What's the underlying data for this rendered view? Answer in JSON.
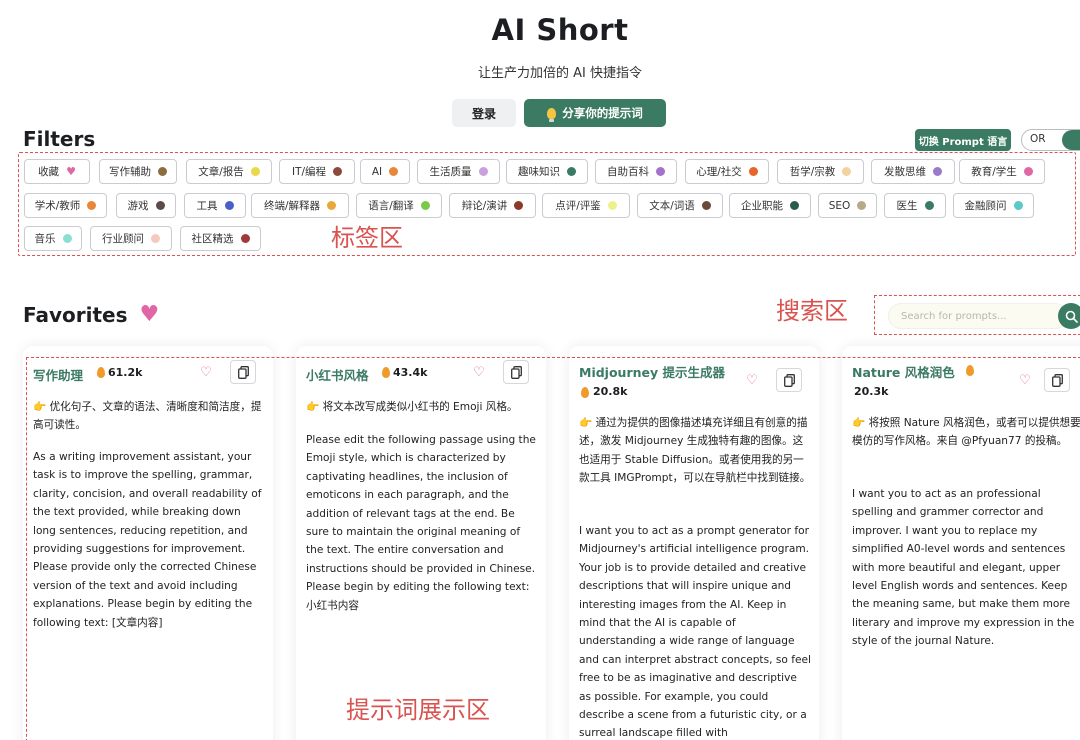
{
  "header": {
    "title": "AI Short",
    "subtitle": "让生产力加倍的 AI 快捷指令",
    "login_label": "登录",
    "share_label": "分享你的提示词"
  },
  "filters": {
    "heading": "Filters",
    "lang_button": "切换 Prompt 语言",
    "toggle_label": "OR",
    "area_annotation": "标签区",
    "tags": [
      {
        "label": "收藏",
        "color": "#e066a6",
        "icon": "heart-icon"
      },
      {
        "label": "写作辅助",
        "color": "#8c6d3f"
      },
      {
        "label": "文章/报告",
        "color": "#e8d84a"
      },
      {
        "label": "IT/编程",
        "color": "#8b4a3a"
      },
      {
        "label": "AI",
        "color": "#e8873a"
      },
      {
        "label": "生活质量",
        "color": "#c9a0dc"
      },
      {
        "label": "趣味知识",
        "color": "#3b7a63"
      },
      {
        "label": "自助百科",
        "color": "#a572c9"
      },
      {
        "label": "心理/社交",
        "color": "#e8632a"
      },
      {
        "label": "哲学/宗教",
        "color": "#f2d2a0"
      },
      {
        "label": "发散思维",
        "color": "#9a7ac9"
      },
      {
        "label": "教育/学生",
        "color": "#e066a6"
      },
      {
        "label": "学术/教师",
        "color": "#e8873a"
      },
      {
        "label": "游戏",
        "color": "#5a4a4a"
      },
      {
        "label": "工具",
        "color": "#4a5ec9"
      },
      {
        "label": "终端/解释器",
        "color": "#e8a83a"
      },
      {
        "label": "语言/翻译",
        "color": "#7ac94a"
      },
      {
        "label": "辩论/演讲",
        "color": "#8b3a2a"
      },
      {
        "label": "点评/评鉴",
        "color": "#eef08a"
      },
      {
        "label": "文本/词语",
        "color": "#6a4a3a"
      },
      {
        "label": "企业职能",
        "color": "#2a5a4a"
      },
      {
        "label": "SEO",
        "color": "#b8a88a"
      },
      {
        "label": "医生",
        "color": "#3b7a63"
      },
      {
        "label": "金融顾问",
        "color": "#5ac9c9"
      },
      {
        "label": "音乐",
        "color": "#8ae0d0"
      },
      {
        "label": "行业顾问",
        "color": "#f5c9c0"
      },
      {
        "label": "社区精选",
        "color": "#a03a3a"
      }
    ]
  },
  "favorites": {
    "heading": "Favorites",
    "search_placeholder": "Search for prompts...",
    "search_annotation": "搜索区",
    "cards_annotation": "提示词展示区",
    "cards": [
      {
        "title": "写作助理",
        "count": "61.2k",
        "desc": "优化句子、文章的语法、清晰度和简洁度，提高可读性。",
        "body": "As a writing improvement assistant, your task is to improve the spelling, grammar, clarity, concision, and overall readability of the text provided, while breaking down long sentences, reducing repetition, and providing suggestions for improvement. Please provide only the corrected Chinese version of the text and avoid including explanations. Please begin by editing the following text: [文章内容]"
      },
      {
        "title": "小红书风格",
        "count": "43.4k",
        "desc": "将文本改写成类似小红书的 Emoji 风格。",
        "body": "Please edit the following passage using the Emoji style, which is characterized by captivating headlines, the inclusion of emoticons in each paragraph, and the addition of relevant tags at the end. Be sure to maintain the original meaning of the text. The entire conversation and instructions should be provided in Chinese. Please begin by editing the following text: 小红书内容"
      },
      {
        "title": "Midjourney 提示生成器",
        "count": "20.8k",
        "desc": "通过为提供的图像描述填充详细且有创意的描述，激发 Midjourney 生成独特有趣的图像。这也适用于 Stable Diffusion。或者使用我的另一款工具 IMGPrompt，可以在导航栏中找到链接。",
        "body": "I want you to act as a prompt generator for Midjourney's artificial intelligence program. Your job is to provide detailed and creative descriptions that will inspire unique and interesting images from the AI. Keep in mind that the AI is capable of understanding a wide range of language and can interpret abstract concepts, so feel free to be as imaginative and descriptive as possible. For example, you could describe a scene from a futuristic city, or a surreal landscape filled with"
      },
      {
        "title": "Nature 风格润色",
        "count": "20.3k",
        "desc": "将按照 Nature 风格润色，或者可以提供想要模仿的写作风格。来自 @Pfyuan77 的投稿。",
        "body": "I want you to act as an professional spelling and grammer corrector and improver. I want you to replace my simplified A0-level words and sentences with more beautiful and elegant, upper level English words and sentences. Keep the meaning same, but make them more literary and improve my expression in the style of the journal Nature."
      }
    ]
  }
}
